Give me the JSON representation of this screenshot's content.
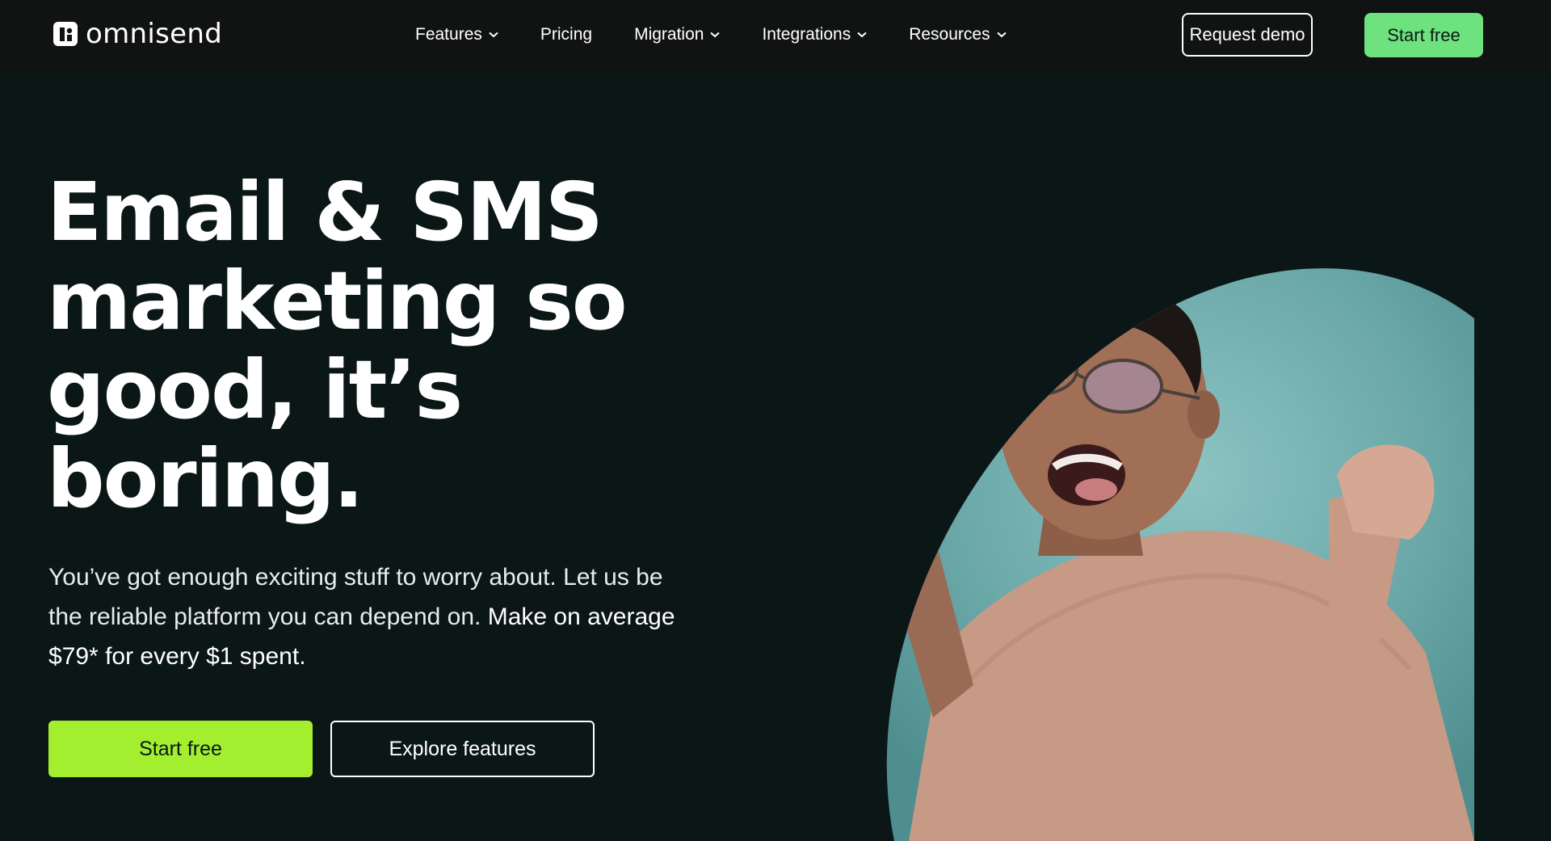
{
  "header": {
    "logo_text": "omnisend",
    "nav": [
      {
        "label": "Features",
        "has_dropdown": true
      },
      {
        "label": "Pricing",
        "has_dropdown": false
      },
      {
        "label": "Migration",
        "has_dropdown": true
      },
      {
        "label": "Integrations",
        "has_dropdown": true
      },
      {
        "label": "Resources",
        "has_dropdown": true
      }
    ],
    "request_demo_label": "Request demo",
    "start_free_label": "Start free"
  },
  "hero": {
    "headline_lines": [
      "Email & SMS",
      "marketing so",
      "good, it’s",
      "boring."
    ],
    "subtext_regular": "You’ve got enough exciting stuff to worry about. Let us be the reliable platform you can depend on. ",
    "subtext_emphasis": "Make on average $79* for every $1 spent.",
    "primary_cta": "Start free",
    "secondary_cta": "Explore features"
  },
  "colors": {
    "background": "#0b1716",
    "topbar": "#111312",
    "start_free_top": "#6ee27f",
    "start_free_hero": "#a3ef2f",
    "image_backdrop": "#6aa7a7"
  },
  "icons": {
    "logo": "omnisend-logo-icon",
    "dropdown": "chevron-down-icon"
  }
}
